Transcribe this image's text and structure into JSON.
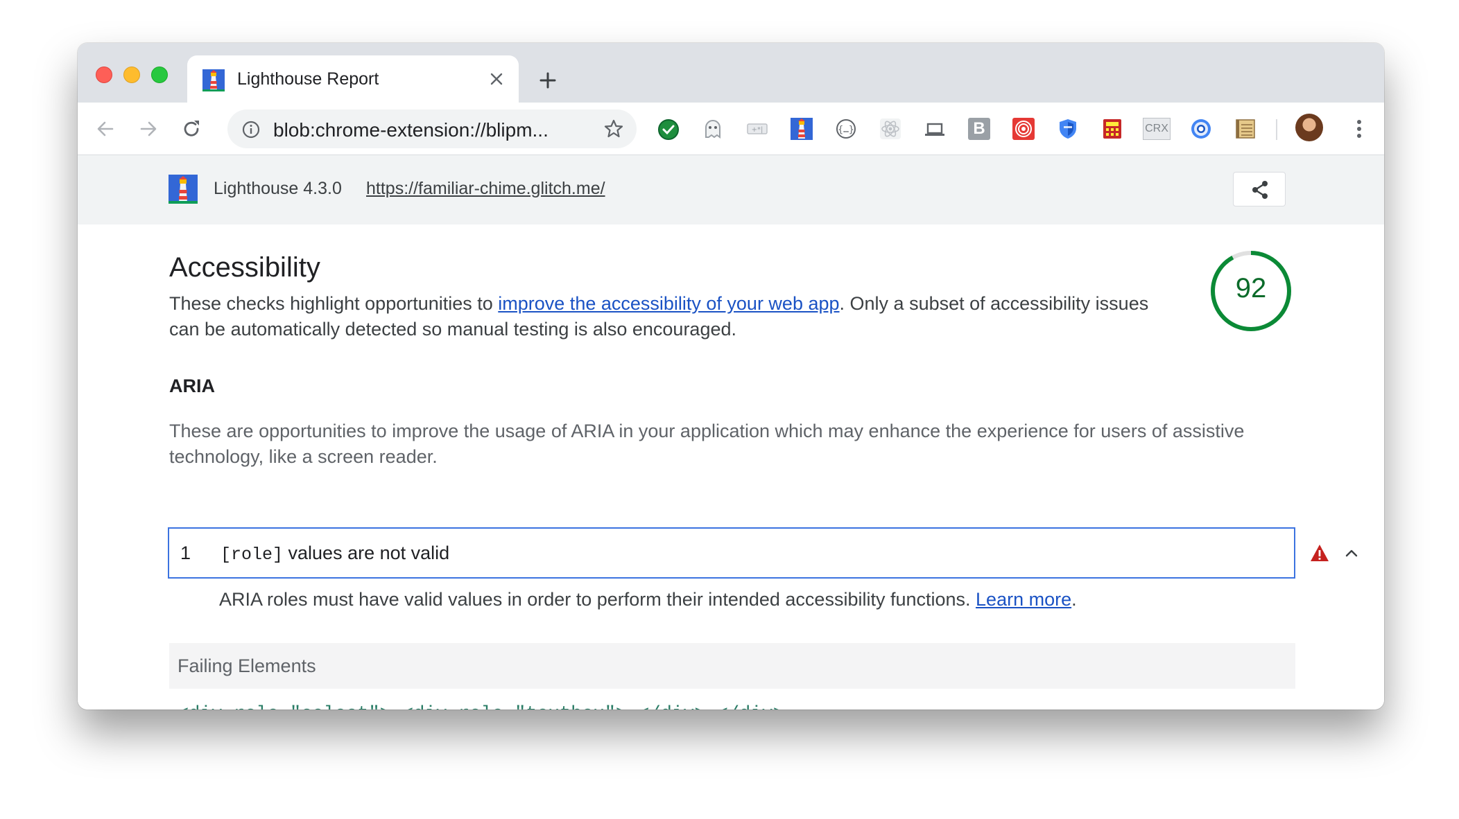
{
  "browser": {
    "tab": {
      "title": "Lighthouse Report"
    },
    "omnibox": {
      "url": "blob:chrome-extension://blipm..."
    },
    "extensions": [
      "green-check-extension-icon",
      "ghost-extension-icon",
      "grey-extension-icon",
      "lighthouse-extension-icon",
      "braces-extension-icon",
      "react-extension-icon",
      "laptop-extension-icon",
      "b-extension-icon",
      "target-extension-icon",
      "shield-extension-icon",
      "calculator-extension-icon",
      "crx-extension-icon",
      "chromium-extension-icon",
      "notepad-extension-icon"
    ],
    "ext_labels": {
      "b": "B",
      "crx": "CRX"
    }
  },
  "lighthouse": {
    "version": "Lighthouse 4.3.0",
    "url": "https://familiar-chime.glitch.me/"
  },
  "category": {
    "title": "Accessibility",
    "desc_before": "These checks highlight opportunities to ",
    "desc_link": "improve the accessibility of your web app",
    "desc_after": ". Only a subset of accessibility issues can be automatically detected so manual testing is also encouraged.",
    "score": "92",
    "score_fraction": 0.92,
    "score_color": "#0b8a36"
  },
  "group": {
    "title": "ARIA",
    "desc": "These are opportunities to improve the usage of ARIA in your application which may enhance the experience for users of assistive technology, like a screen reader."
  },
  "audit": {
    "index": "1",
    "code": "[role]",
    "title": " values are not valid",
    "desc": "ARIA roles must have valid values in order to perform their intended accessibility functions. ",
    "learn_more": "Learn more",
    "desc_end": ".",
    "warn_color": "#c5221f"
  },
  "failing": {
    "label": "Failing Elements",
    "snippet": "<div role=\"select\"> <div role=\"textbox\"> </div> </div>"
  }
}
